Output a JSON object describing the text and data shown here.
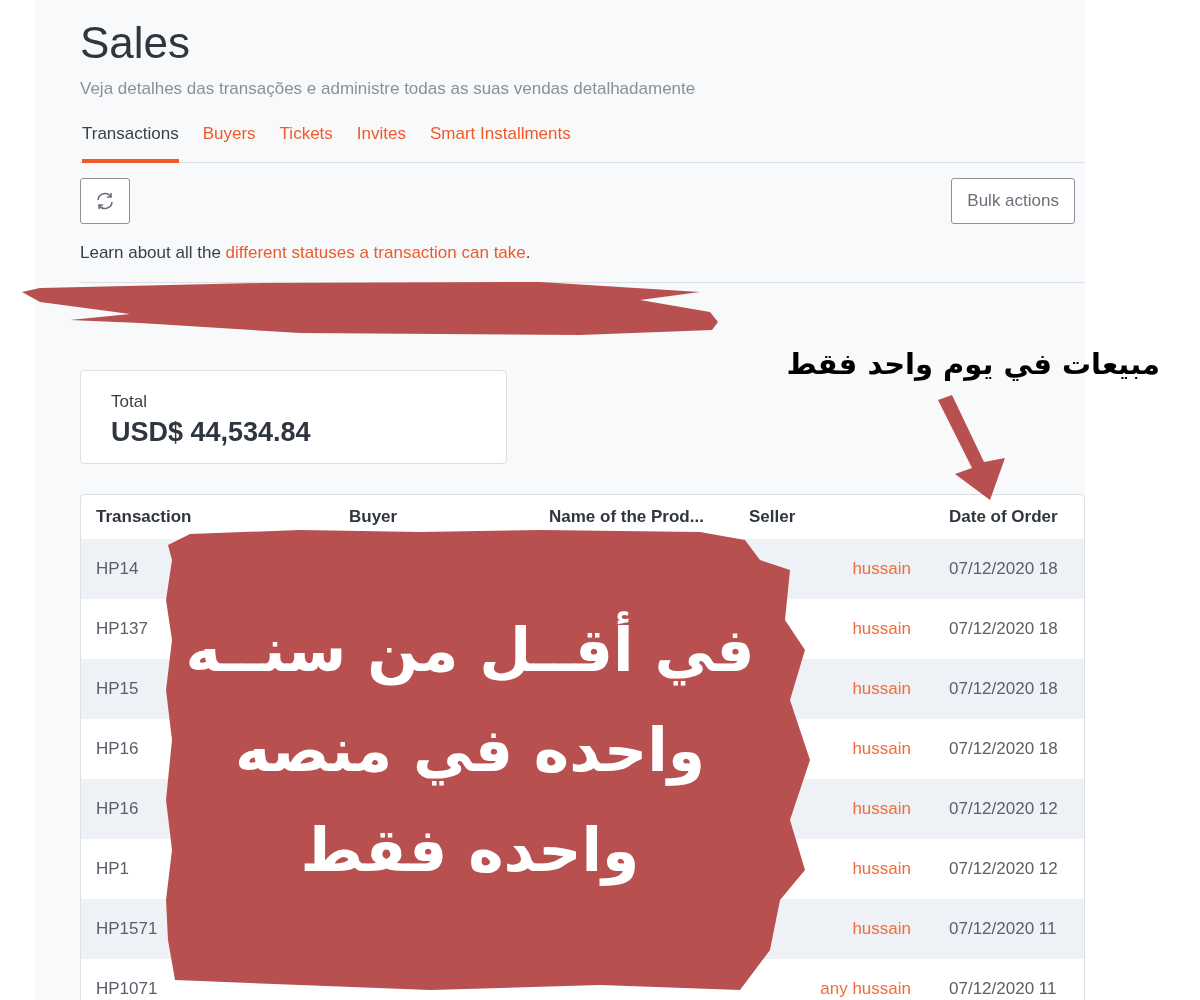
{
  "page": {
    "title": "Sales",
    "subtitle": "Veja detalhes das transações e administre todas as suas vendas detalhadamente"
  },
  "tabs": [
    {
      "label": "Transactions",
      "selected": true
    },
    {
      "label": "Buyers",
      "selected": false
    },
    {
      "label": "Tickets",
      "selected": false
    },
    {
      "label": "Invites",
      "selected": false
    },
    {
      "label": "Smart Installments",
      "selected": false
    }
  ],
  "toolbar": {
    "bulk_actions": "Bulk actions"
  },
  "info": {
    "text": "Learn about all the ",
    "link": "different statuses a transaction can take",
    "end": "."
  },
  "total": {
    "label": "Total",
    "value": "USD$ 44,534.84"
  },
  "table": {
    "columns": [
      "Transaction",
      "Buyer",
      "Name of the Prod...",
      "Seller",
      "Date of Order"
    ],
    "rows": [
      {
        "transaction": "HP14",
        "seller": "hussain",
        "date": "07/12/2020 18",
        "shaded": true
      },
      {
        "transaction": "HP137",
        "seller": "hussain",
        "date": "07/12/2020 18",
        "shaded": false
      },
      {
        "transaction": "HP15",
        "seller": "hussain",
        "date": "07/12/2020 18",
        "shaded": true
      },
      {
        "transaction": "HP16",
        "seller": "hussain",
        "date": "07/12/2020 18",
        "shaded": false
      },
      {
        "transaction": "HP16",
        "seller": "hussain",
        "date": "07/12/2020 12",
        "shaded": true
      },
      {
        "transaction": "HP1",
        "seller": "hussain",
        "date": "07/12/2020 12",
        "shaded": false
      },
      {
        "transaction": "HP1571",
        "seller": "hussain",
        "date": "07/12/2020 11",
        "shaded": true
      },
      {
        "transaction": "HP1071",
        "seller": "any hussain",
        "date": "07/12/2020 11",
        "shaded": false
      }
    ]
  },
  "overlay": {
    "caption": "مبيعات في يوم واحد فقط",
    "banner_lines": [
      "في أقــل من سنــه",
      "واحده في منصه",
      "واحده فقط"
    ]
  }
}
